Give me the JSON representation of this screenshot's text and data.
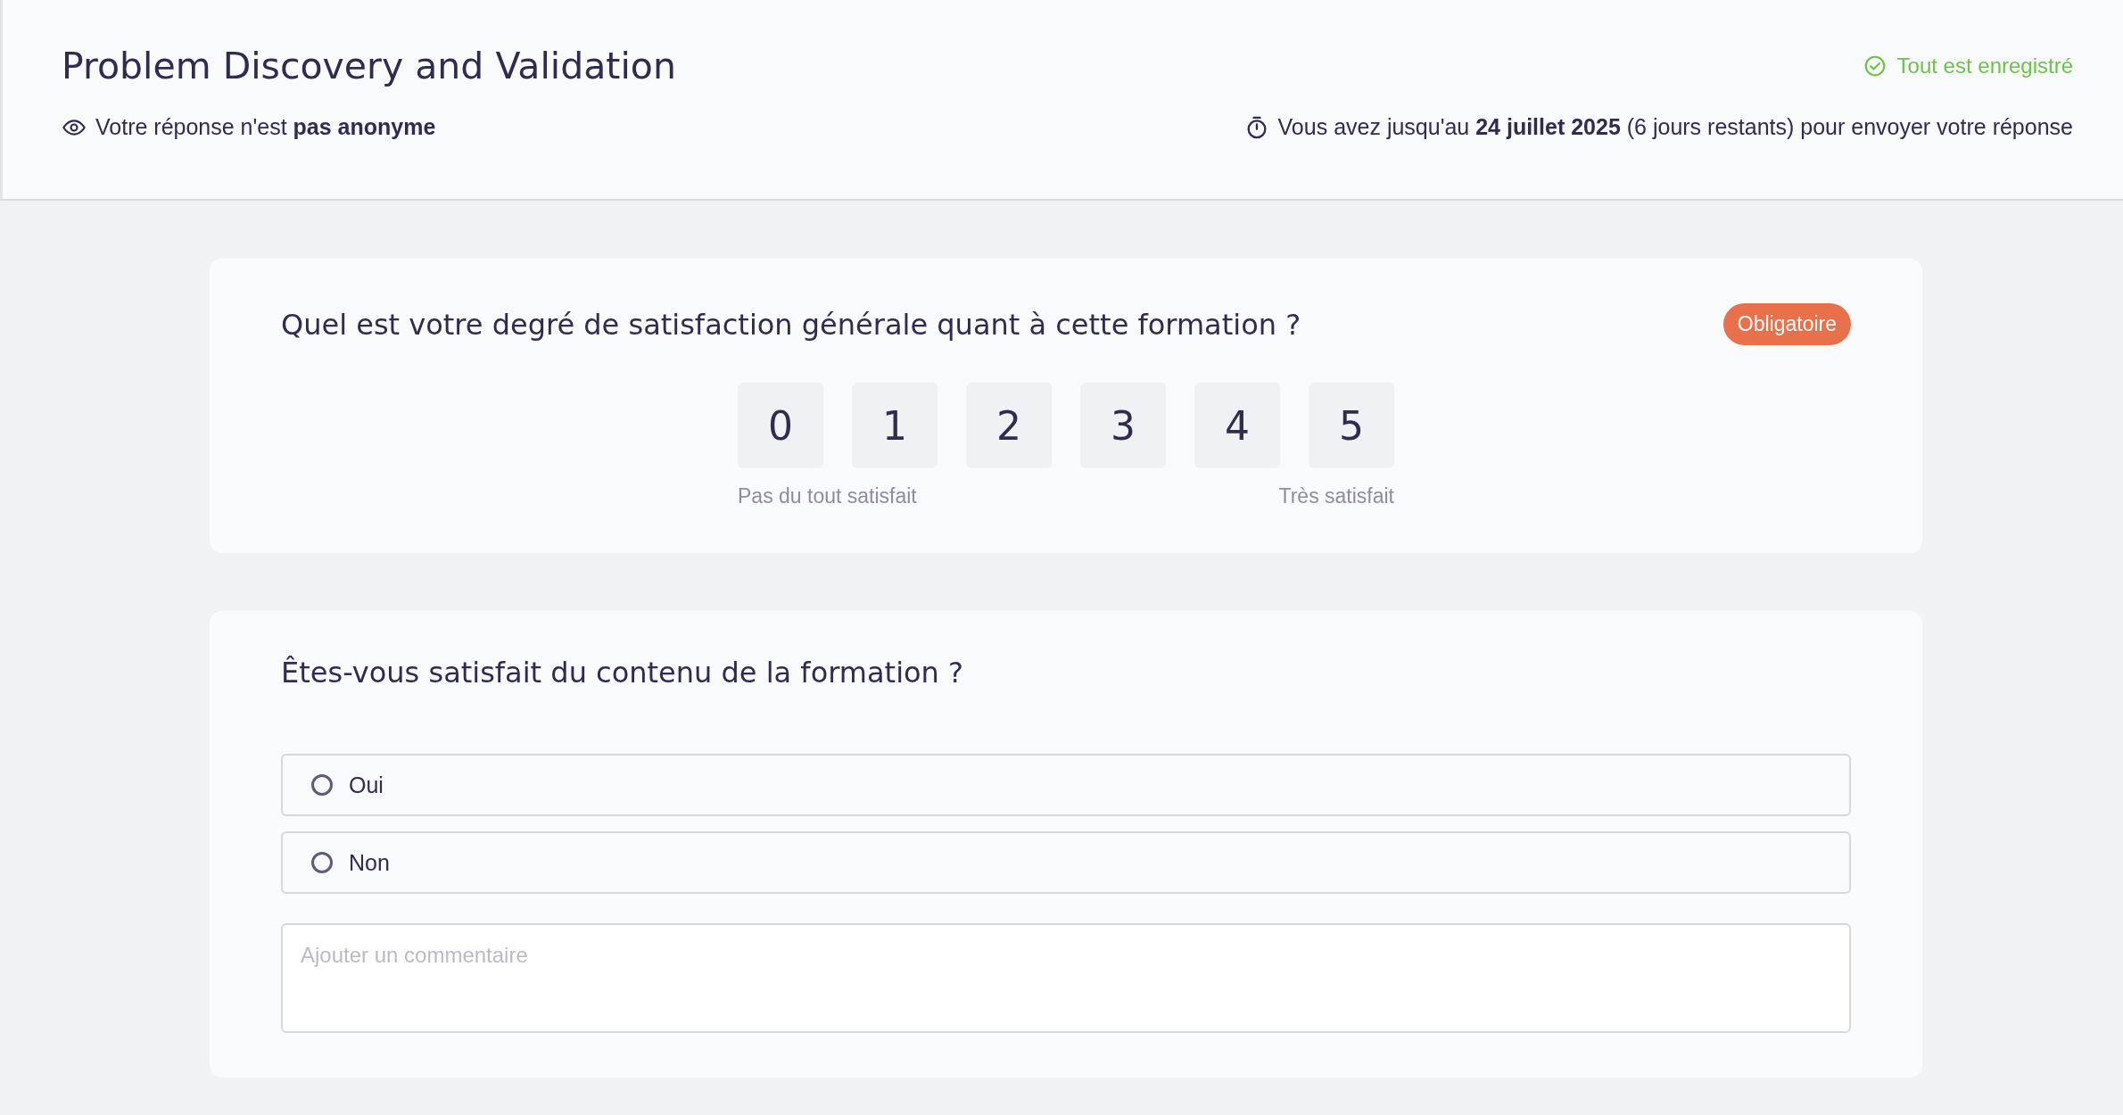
{
  "header": {
    "title": "Problem Discovery and Validation",
    "save_status": "Tout est enregistré",
    "anonymity": "Votre réponse n'est **pas anonyme**",
    "deadline": "Vous avez jusqu'au **24 juillet 2025** (6 jours restants) pour envoyer votre réponse"
  },
  "questions": [
    {
      "kind": "scale",
      "text": "Quel est votre degré de satisfaction générale quant à cette formation ?",
      "badge": "Obligatoire",
      "options": [
        {
          "label": "0",
          "selected": false
        },
        {
          "label": "1",
          "selected": false
        },
        {
          "label": "2",
          "selected": false
        },
        {
          "label": "3",
          "selected": false
        },
        {
          "label": "4",
          "selected": false
        },
        {
          "label": "5",
          "selected": false
        }
      ],
      "min_label": "Pas du tout satisfait",
      "max_label": "Très satisfait"
    },
    {
      "kind": "choice",
      "text": "Êtes-vous satisfait du contenu de la formation ?",
      "options": [
        {
          "label": "Oui",
          "selected": false
        },
        {
          "label": "Non",
          "selected": false
        }
      ],
      "comment": {
        "placeholder": "Ajouter un commentaire"
      }
    }
  ]
}
